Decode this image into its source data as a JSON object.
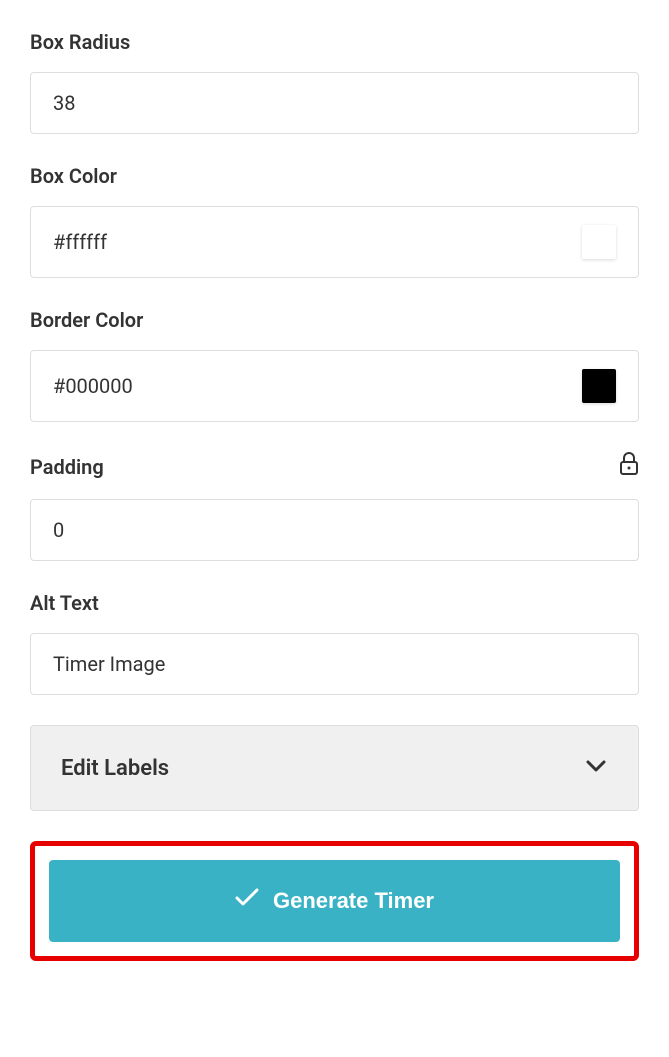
{
  "fields": {
    "boxRadius": {
      "label": "Box Radius",
      "value": "38"
    },
    "boxColor": {
      "label": "Box Color",
      "value": "#ffffff",
      "swatch": "#ffffff"
    },
    "borderColor": {
      "label": "Border Color",
      "value": "#000000",
      "swatch": "#000000"
    },
    "padding": {
      "label": "Padding",
      "value": "0"
    },
    "altText": {
      "label": "Alt Text",
      "value": "Timer Image"
    }
  },
  "accordion": {
    "label": "Edit Labels"
  },
  "generateButton": {
    "label": "Generate Timer"
  }
}
